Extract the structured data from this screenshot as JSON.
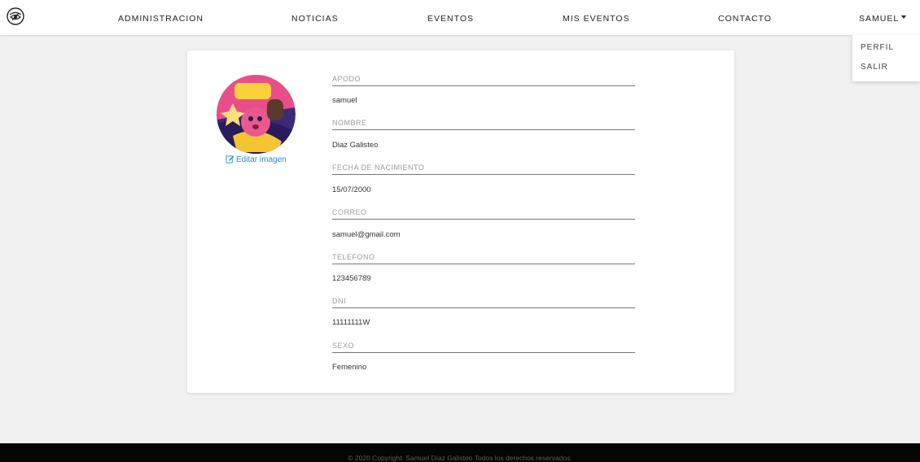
{
  "nav": {
    "logo": "eye-logo-icon",
    "links": [
      "ADMINISTRACION",
      "NOTICIAS",
      "EVENTOS",
      "MIS EVENTOS",
      "CONTACTO"
    ],
    "user": "SAMUEL",
    "dropdown": [
      "PERFIL",
      "SALIR"
    ]
  },
  "profile": {
    "avatar": "profile-avatar-image",
    "edit_image": "Editar imagen",
    "fields": [
      {
        "label": "APODO",
        "value": "samuel"
      },
      {
        "label": "NOMBRE",
        "value": "Diaz Galisteo"
      },
      {
        "label": "FECHA DE NACIMIENTO",
        "value": "15/07/2000"
      },
      {
        "label": "CORREO",
        "value": "samuel@gmail.com"
      },
      {
        "label": "TELEFONO",
        "value": "123456789"
      },
      {
        "label": "DNI",
        "value": "11111111W"
      },
      {
        "label": "SEXO",
        "value": "Femenino"
      }
    ]
  },
  "footer": {
    "text": "© 2020 Copyright: Samuel Díaz Galisteo Todos los derechos reservados."
  },
  "colors": {
    "background": "#f1f1f1",
    "link": "#1f8fd6",
    "footer": "#050505"
  }
}
